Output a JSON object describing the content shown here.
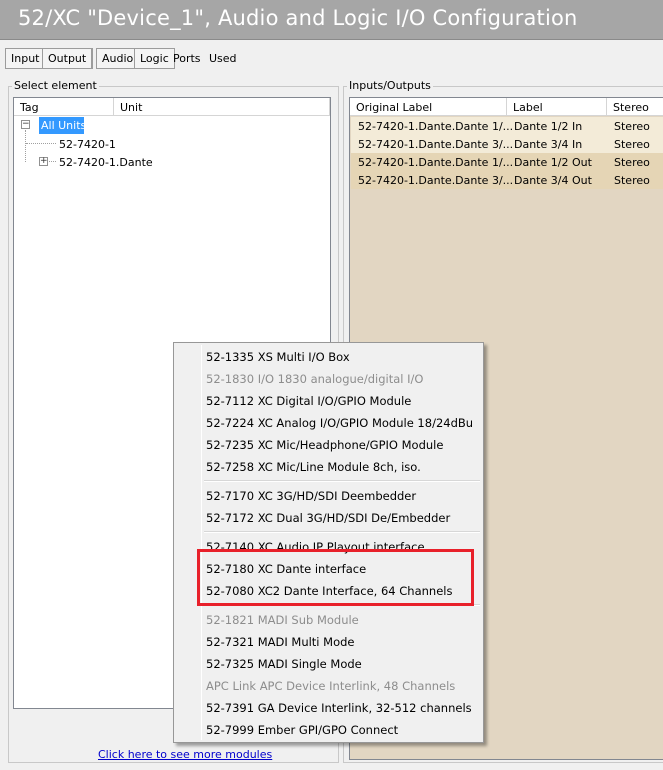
{
  "window": {
    "title": "52/XC \"Device_1\", Audio and Logic I/O  Configuration"
  },
  "toolbar": {
    "input": "Input",
    "output": "Output",
    "audio": "Audio",
    "logic": "Logic",
    "ports": "Ports",
    "used": "Used"
  },
  "select_element": {
    "title": "Select element",
    "columns": {
      "tag": "Tag",
      "unit": "Unit"
    },
    "tree": {
      "root": "All Units",
      "child1": "52-7420-1",
      "child2": "52-7420-1.Dante"
    }
  },
  "io": {
    "title": "Inputs/Outputs",
    "columns": {
      "original": "Original Label",
      "label": "Label",
      "stereo": "Stereo"
    },
    "rows": [
      {
        "original": "52-7420-1.Dante.Dante 1/...",
        "label": "Dante 1/2 In",
        "stereo": "Stereo"
      },
      {
        "original": "52-7420-1.Dante.Dante 3/...",
        "label": "Dante 3/4 In",
        "stereo": "Stereo"
      },
      {
        "original": "52-7420-1.Dante.Dante 1/...",
        "label": "Dante 1/2 Out",
        "stereo": "Stereo"
      },
      {
        "original": "52-7420-1.Dante.Dante 3/...",
        "label": "Dante 3/4 Out",
        "stereo": "Stereo"
      }
    ]
  },
  "more_modules_link": "Click here to see more modules",
  "menu": {
    "items": [
      {
        "label": "52-1335 XS Multi I/O Box",
        "enabled": true
      },
      {
        "label": "52-1830 I/O 1830 analogue/digital I/O",
        "enabled": false
      },
      {
        "label": "52-7112 XC Digital I/O/GPIO Module",
        "enabled": true
      },
      {
        "label": "52-7224 XC Analog I/O/GPIO Module 18/24dBu",
        "enabled": true
      },
      {
        "label": "52-7235 XC Mic/Headphone/GPIO Module",
        "enabled": true
      },
      {
        "label": "52-7258 XC Mic/Line Module 8ch, iso.",
        "enabled": true
      },
      {
        "label": "52-7170 XC 3G/HD/SDI Deembedder",
        "enabled": true
      },
      {
        "label": "52-7172 XC Dual 3G/HD/SDI De/Embedder",
        "enabled": true
      },
      {
        "label": "52-7140 XC Audio IP Playout interface",
        "enabled": true
      },
      {
        "label": "52-7180 XC Dante interface",
        "enabled": true
      },
      {
        "label": "52-7080 XC2 Dante Interface, 64 Channels",
        "enabled": true
      },
      {
        "label": "52-1821 MADI Sub Module",
        "enabled": false
      },
      {
        "label": "52-7321 MADI Multi Mode",
        "enabled": true
      },
      {
        "label": "52-7325 MADI Single Mode",
        "enabled": true
      },
      {
        "label": "APC Link APC Device Interlink, 48 Channels",
        "enabled": false
      },
      {
        "label": "52-7391 GA Device Interlink, 32-512 channels",
        "enabled": true
      },
      {
        "label": "52-7999 Ember GPI/GPO Connect",
        "enabled": true
      }
    ]
  },
  "colors": {
    "title_bar": "#a6a6a6",
    "selected_row": "#3399ff",
    "io_row_light": "#f3ebd8",
    "io_row_dark": "#e5d5b5",
    "io_background": "#e2d6c2",
    "highlight": "#e8202a",
    "link": "#0000cc",
    "disabled_text": "#8d8d8d"
  }
}
